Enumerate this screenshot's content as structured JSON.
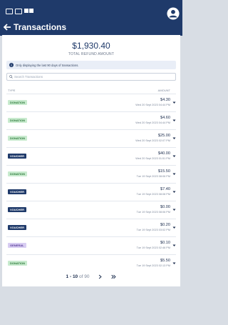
{
  "header": {
    "title": "Transactions"
  },
  "summary": {
    "total_amount": "$1,930.40",
    "total_label": "TOTAL REFUND AMOUNT"
  },
  "info": {
    "text": "Only displaying the last 90 days of transactions."
  },
  "search": {
    "placeholder": "Search Transactions"
  },
  "table": {
    "col_type": "TYPE",
    "col_amount": "AMOUNT",
    "rows": [
      {
        "type": "DONATION",
        "kind": "donation",
        "amount": "$4.30",
        "date": "Wed 20 Sept 2023 04:44 PM"
      },
      {
        "type": "DONATION",
        "kind": "donation",
        "amount": "$4.60",
        "date": "Wed 20 Sept 2023 04:44 PM"
      },
      {
        "type": "DONATION",
        "kind": "donation",
        "amount": "$25.00",
        "date": "Wed 20 Sept 2023 02:07 PM"
      },
      {
        "type": "VOUCHER",
        "kind": "voucher",
        "amount": "$40.00",
        "date": "Wed 20 Sept 2023 01:51 PM"
      },
      {
        "type": "DONATION",
        "kind": "donation",
        "amount": "$15.50",
        "date": "Tue 19 Sept 2023 08:06 PM"
      },
      {
        "type": "VOUCHER",
        "kind": "voucher",
        "amount": "$7.40",
        "date": "Tue 19 Sept 2023 08:08 PM"
      },
      {
        "type": "VOUCHER",
        "kind": "voucher",
        "amount": "$0.00",
        "date": "Tue 19 Sept 2023 08:06 PM"
      },
      {
        "type": "VOUCHER",
        "kind": "voucher",
        "amount": "$0.20",
        "date": "Tue 19 Sept 2023 03:02 PM"
      },
      {
        "type": "GENERAL",
        "kind": "general",
        "amount": "$0.10",
        "date": "Tue 19 Sept 2023 02:46 PM"
      },
      {
        "type": "DONATION",
        "kind": "donation",
        "amount": "$5.50",
        "date": "Tue 19 Sept 2023 02:13 PM"
      }
    ]
  },
  "pagination": {
    "range": "1 - 10",
    "of": "of 90"
  },
  "colors": {
    "header_bg": "#1f3a6a",
    "donation_badge": "#c9ebcf",
    "voucher_badge": "#1f3a6a",
    "general_badge": "#d8cdf2"
  }
}
